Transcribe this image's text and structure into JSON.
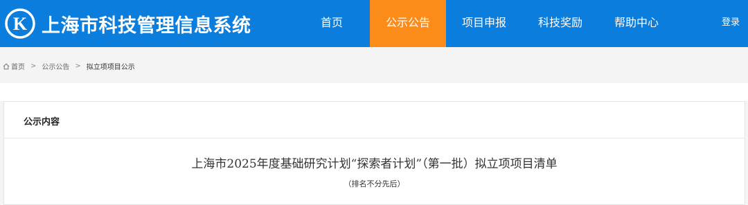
{
  "header": {
    "logo_icon": "k-circle-logo",
    "site_title": "上海市科技管理信息系统",
    "nav": [
      {
        "label": "首页",
        "active": false
      },
      {
        "label": "公示公告",
        "active": true
      },
      {
        "label": "项目申报",
        "active": false
      },
      {
        "label": "科技奖励",
        "active": false
      },
      {
        "label": "帮助中心",
        "active": false
      }
    ],
    "login_label": "登录"
  },
  "breadcrumb": {
    "home_icon": "home-icon",
    "home": "首页",
    "separator": ">",
    "section": "公示公告",
    "current": "拟立项项目公示"
  },
  "panel": {
    "title": "公示内容",
    "doc_title": "上海市2025年度基础研究计划“探索者计划”（第一批）拟立项项目清单",
    "doc_subtitle": "（排名不分先后）"
  },
  "colors": {
    "header_bg": "#0b7ddd",
    "active_nav_bg": "#fb8c19",
    "page_bg": "#f4f4f4"
  }
}
